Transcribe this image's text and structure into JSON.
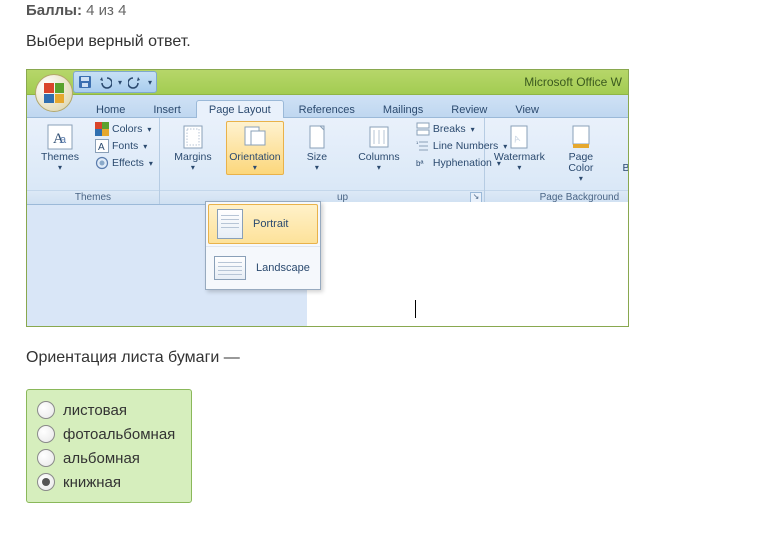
{
  "points": {
    "label": "Баллы:",
    "value": "4 из 4"
  },
  "prompt": "Выбери верный ответ.",
  "question": "Ориентация листа бумаги —",
  "answers": [
    {
      "label": "листовая",
      "selected": false
    },
    {
      "label": "фотоальбомная",
      "selected": false
    },
    {
      "label": "альбомная",
      "selected": false
    },
    {
      "label": "книжная",
      "selected": true
    }
  ],
  "app": {
    "title": "Microsoft Office W",
    "tabs": [
      "Home",
      "Insert",
      "Page Layout",
      "References",
      "Mailings",
      "Review",
      "View"
    ],
    "active_tab": 2,
    "qat": [
      "save-icon",
      "undo-icon",
      "redo-icon",
      "customize-icon"
    ],
    "groups": {
      "themes": {
        "label": "Themes",
        "big": {
          "label": "Themes"
        },
        "items": [
          "Colors",
          "Fonts",
          "Effects"
        ]
      },
      "page_setup": {
        "label_fragment": "up",
        "items": {
          "margins": "Margins",
          "orientation": "Orientation",
          "size": "Size",
          "columns": "Columns",
          "breaks": "Breaks",
          "line_numbers": "Line Numbers",
          "hyphenation": "Hyphenation"
        },
        "popup": [
          {
            "label": "Portrait",
            "selected": true
          },
          {
            "label": "Landscape",
            "selected": false
          }
        ]
      },
      "page_background": {
        "label": "Page Background",
        "items": {
          "watermark": "Watermark",
          "page_color": "Page\nColor",
          "page_borders": "Page\nBorders"
        }
      }
    }
  }
}
